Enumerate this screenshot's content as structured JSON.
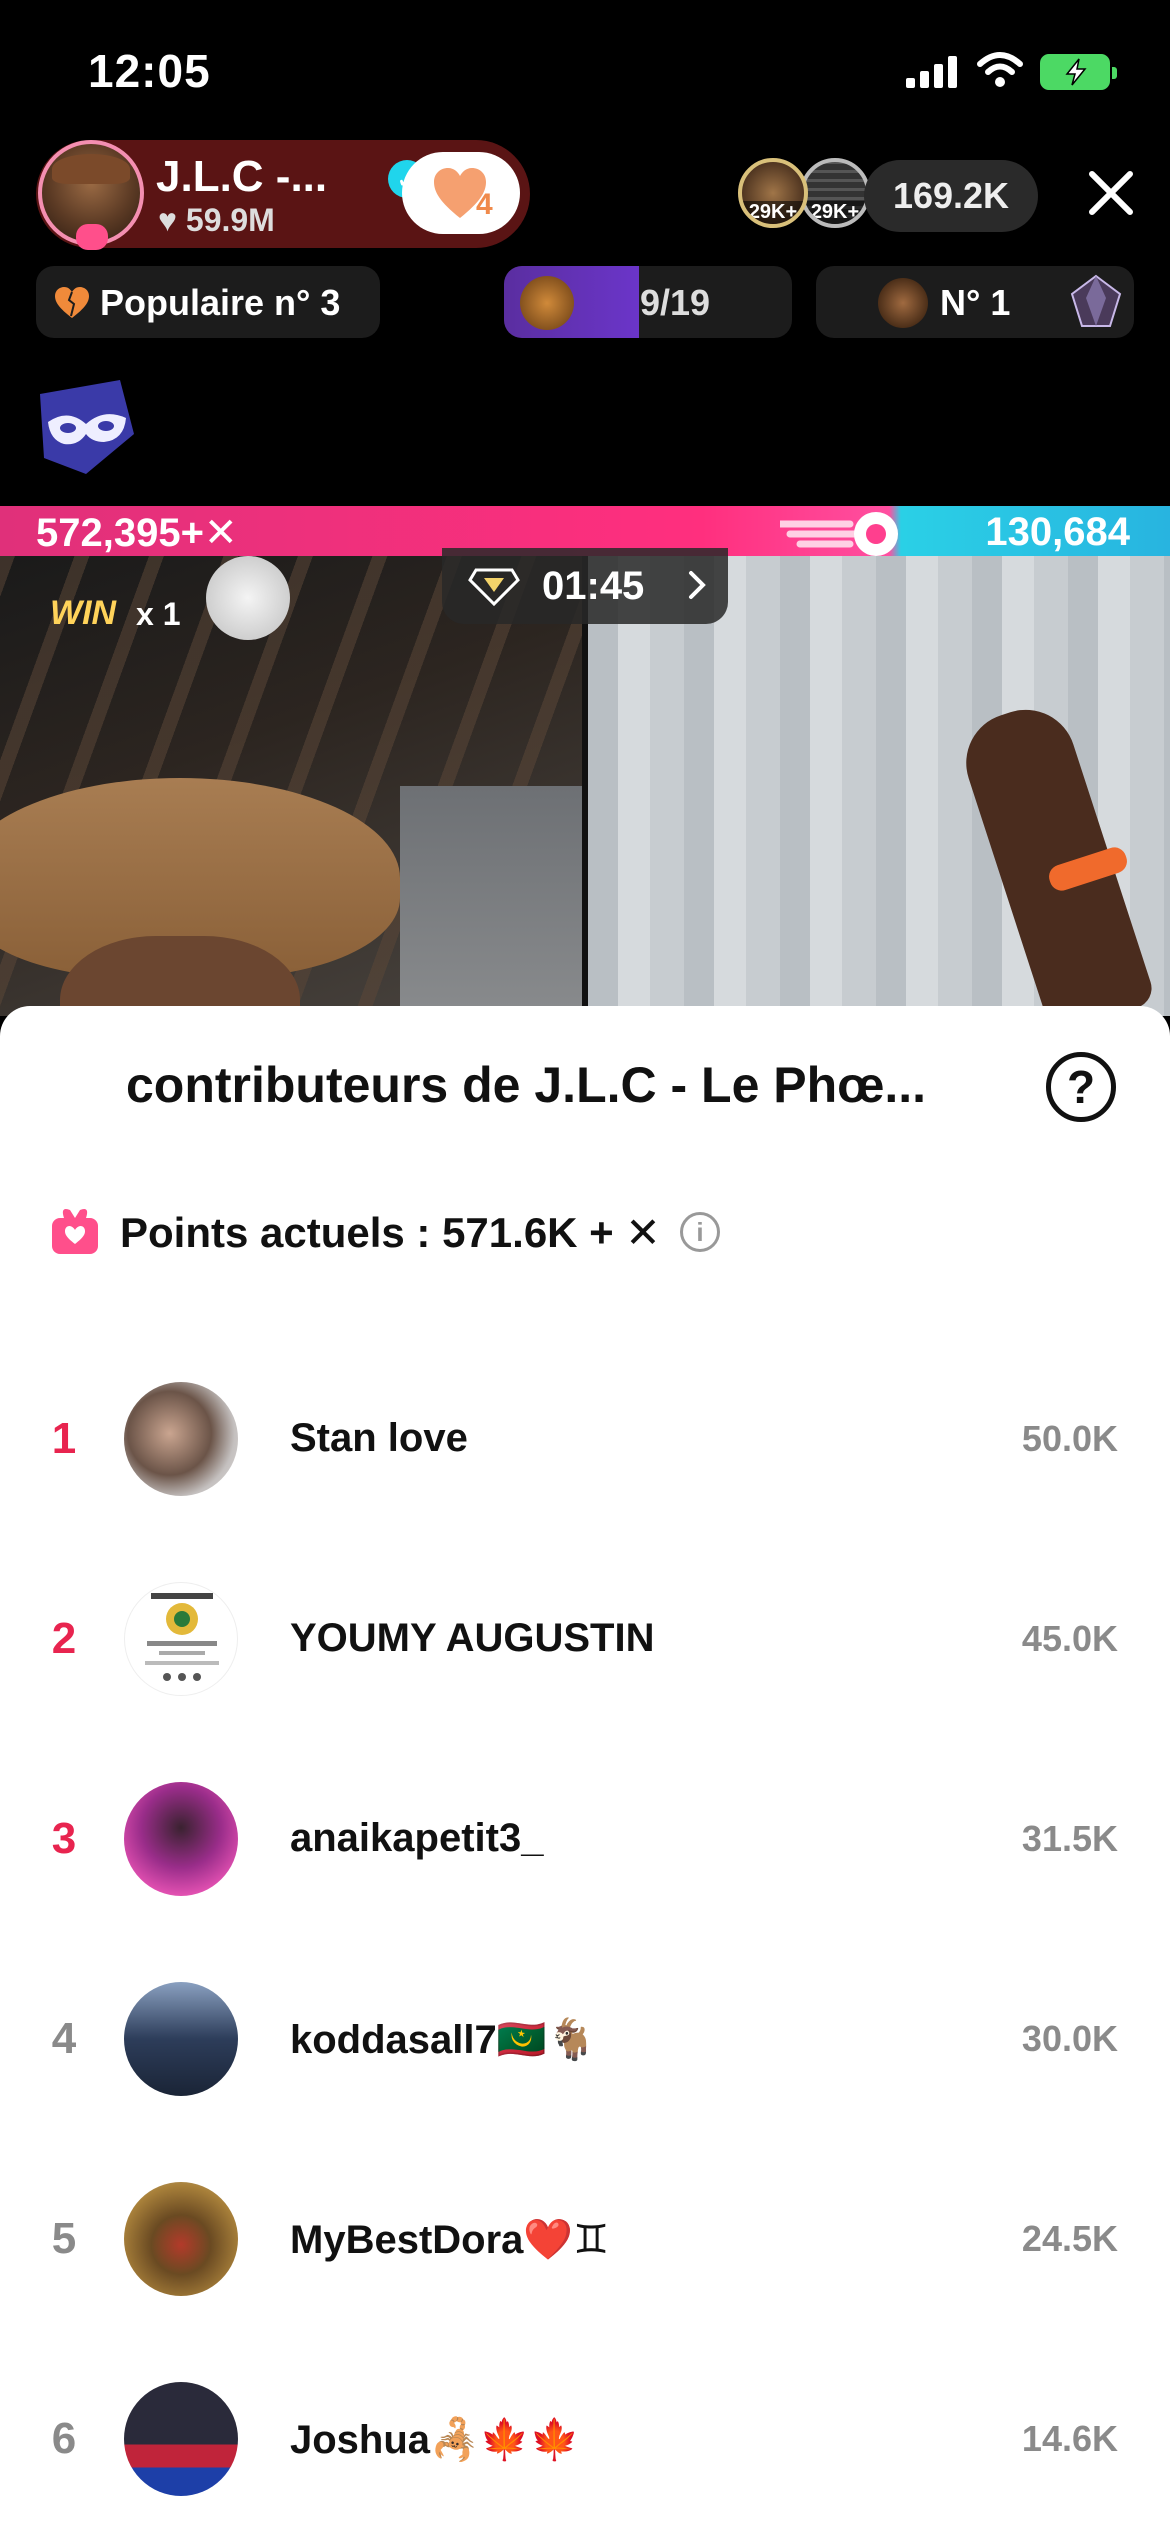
{
  "status_bar": {
    "time": "12:05"
  },
  "host": {
    "name": "J.L.C -...",
    "likes": "59.9M",
    "follow_count": "4"
  },
  "viewers": {
    "tag_a": "29K+",
    "tag_b": "29K+",
    "count": "169.2K"
  },
  "chips": {
    "popular": "Populaire n° 3",
    "progress": "9/19",
    "progress_fraction": 0.47,
    "rank": "N° 1"
  },
  "battle": {
    "left_score": "572,395+✕",
    "right_score": "130,684",
    "win_label": "WIN",
    "win_mult": "x 1",
    "timer": "01:45"
  },
  "sheet": {
    "title": "contributeurs de  J.L.C - Le Phœ...",
    "help": "?",
    "points_text": "Points actuels : 571.6K + ✕",
    "info": "i"
  },
  "contributors": [
    {
      "rank": "1",
      "name": "Stan love",
      "score": "50.0K"
    },
    {
      "rank": "2",
      "name": "YOUMY AUGUSTIN",
      "score": "45.0K"
    },
    {
      "rank": "3",
      "name": "anaikapetit3_",
      "score": "31.5K"
    },
    {
      "rank": "4",
      "name": "koddasall7🇲🇷🐐",
      "score": "30.0K"
    },
    {
      "rank": "5",
      "name": "MyBestDora❤️♊",
      "score": "24.5K"
    },
    {
      "rank": "6",
      "name": "Joshua🦂🍁🍁",
      "score": "14.6K"
    }
  ],
  "colors": {
    "top_rank": "#e8244f",
    "battle_pink": "#ff2f7e",
    "battle_cyan": "#2ad0e6",
    "verified": "#20d5ec"
  }
}
